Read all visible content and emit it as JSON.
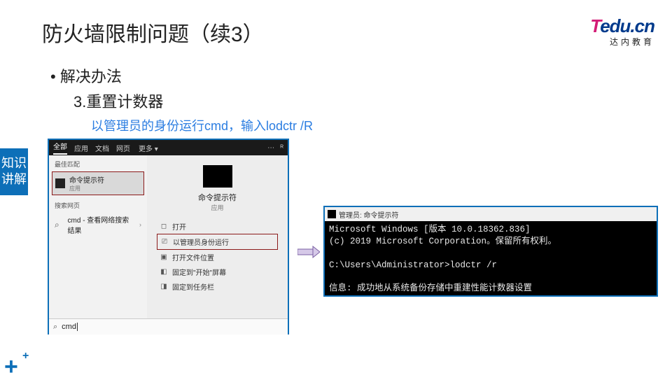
{
  "slide": {
    "title": "防火墙限制问题（续3）",
    "bullet_main": "• 解决办法",
    "bullet_sub": "3.重置计数器",
    "instruction": "以管理员的身份运行cmd，输入lodctr /R",
    "side_tab": "知识讲解"
  },
  "logo": {
    "t": "T",
    "edu": "edu",
    "cn": ".cn",
    "sub": "达内教育"
  },
  "search": {
    "tabs": {
      "all": "全部",
      "app": "应用",
      "doc": "文档",
      "web": "网页",
      "more": "更多 ▾"
    },
    "section_best": "最佳匹配",
    "best_item": {
      "title": "命令提示符",
      "sub": "应用"
    },
    "section_web": "搜索网页",
    "web_item": "cmd - 查看网络搜索结果",
    "right": {
      "title": "命令提示符",
      "sub": "应用"
    },
    "menu": {
      "open": "打开",
      "admin": "以管理员身份运行",
      "file": "打开文件位置",
      "pin_start": "固定到\"开始\"屏幕",
      "pin_task": "固定到任务栏"
    },
    "input": "cmd"
  },
  "cmd": {
    "title": "管理员: 命令提示符",
    "lines": "Microsoft Windows [版本 10.0.18362.836]\n(c) 2019 Microsoft Corporation。保留所有权利。\n\nC:\\Users\\Administrator>lodctr /r\n\n信息: 成功地从系统备份存储中重建性能计数器设置\nC:\\Users\\Administrator>"
  }
}
